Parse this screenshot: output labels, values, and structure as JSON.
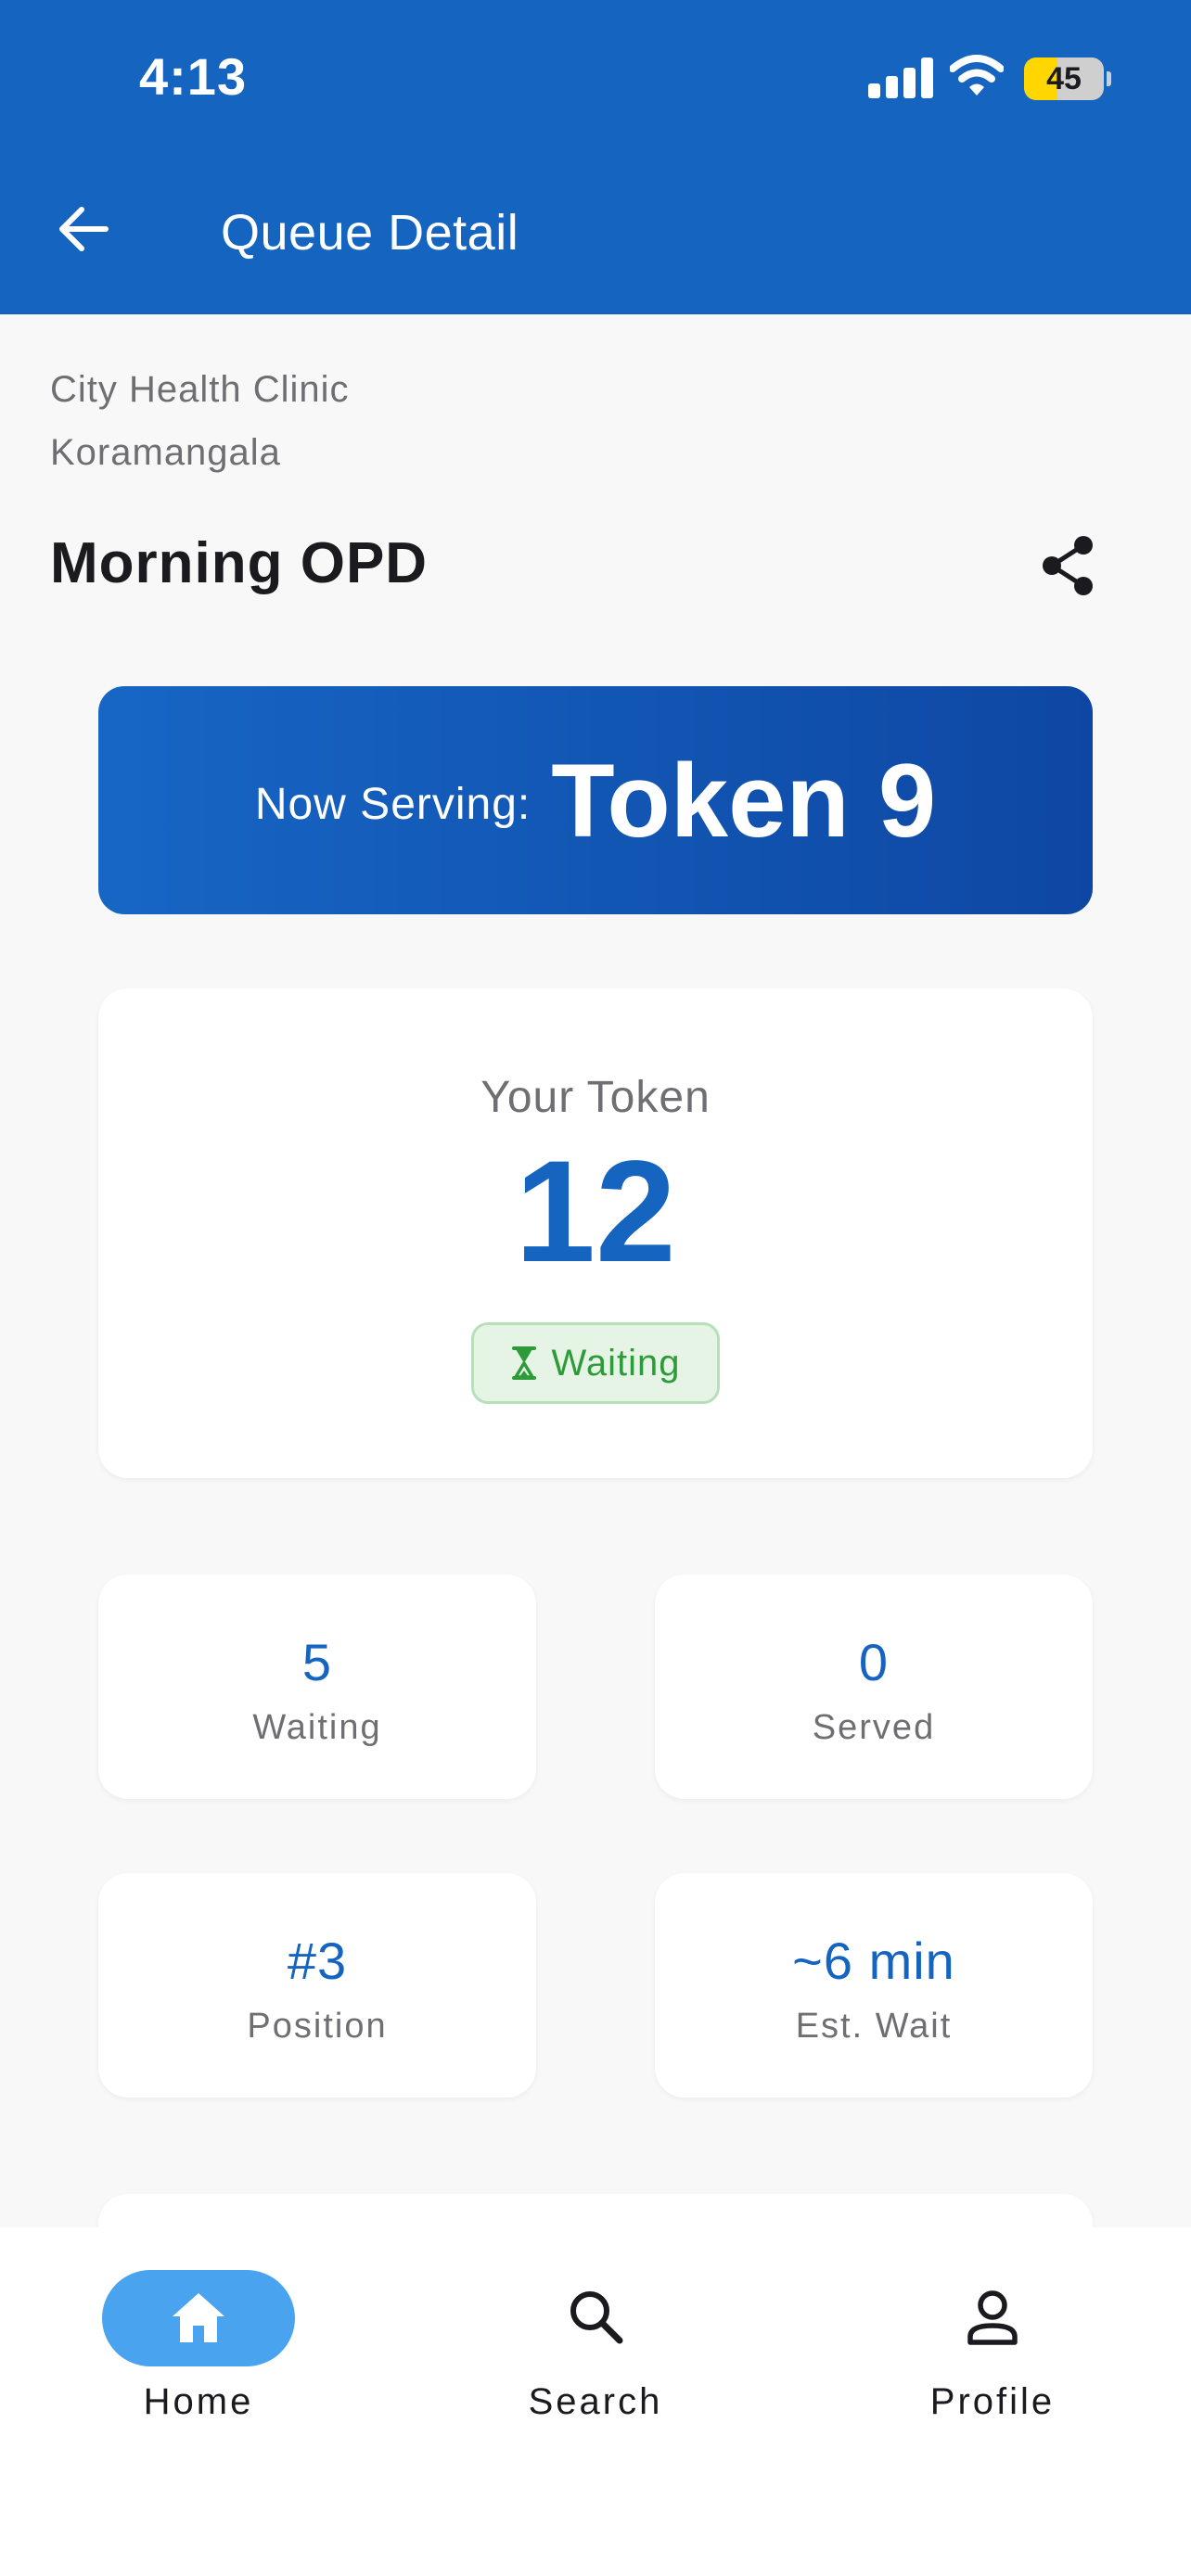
{
  "status_bar": {
    "time": "4:13",
    "battery": "45"
  },
  "header": {
    "title": "Queue Detail"
  },
  "clinic": {
    "name": "City Health Clinic",
    "area": "Koramangala"
  },
  "session": {
    "name": "Morning OPD"
  },
  "now_serving": {
    "label": "Now Serving:",
    "token": "Token 9"
  },
  "your_token": {
    "label": "Your Token",
    "number": "12",
    "status": "Waiting"
  },
  "stats": [
    {
      "value": "5",
      "label": "Waiting"
    },
    {
      "value": "0",
      "label": "Served"
    },
    {
      "value": "#3",
      "label": "Position"
    },
    {
      "value": "~6 min",
      "label": "Est. Wait"
    }
  ],
  "nav": [
    {
      "label": "Home",
      "icon": "home-icon",
      "active": true
    },
    {
      "label": "Search",
      "icon": "search-icon",
      "active": false
    },
    {
      "label": "Profile",
      "icon": "person-icon",
      "active": false
    }
  ],
  "colors": {
    "primary": "#1565c0",
    "banner_end": "#0e47a3",
    "status_green": "#2e9b3a",
    "chip_bg": "#e6f4e6",
    "nav_active": "#4aa3ee",
    "battery": "#ffd600"
  }
}
